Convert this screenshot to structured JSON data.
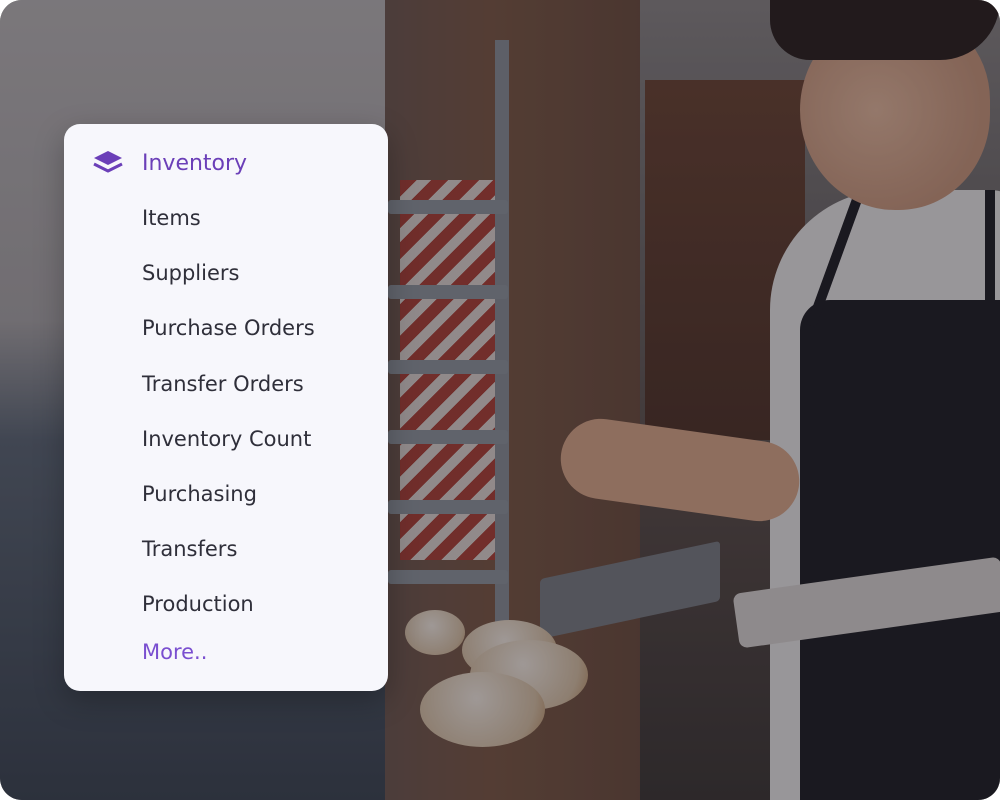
{
  "menu": {
    "icon": "layers-icon",
    "accent_color": "#6b3fb8",
    "title": "Inventory",
    "items": [
      {
        "label": "Items"
      },
      {
        "label": "Suppliers"
      },
      {
        "label": "Purchase Orders"
      },
      {
        "label": "Transfer Orders"
      },
      {
        "label": "Inventory Count"
      },
      {
        "label": "Purchasing"
      },
      {
        "label": "Transfers"
      },
      {
        "label": "Production"
      }
    ],
    "more_label": "More.."
  }
}
